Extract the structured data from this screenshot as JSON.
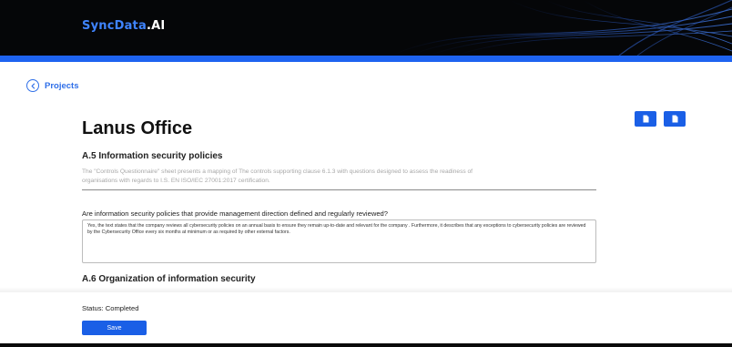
{
  "header": {
    "brand_part1": "SyncData",
    "brand_part2": ".AI",
    "colors": {
      "background": "#050608",
      "brand_blue": "#3f84ff",
      "accent_bar": "#1e63f0"
    }
  },
  "nav": {
    "back_label": "Projects",
    "back_icon": "chevron-left-icon"
  },
  "actions": [
    {
      "icon": "document-icon"
    },
    {
      "icon": "document-icon"
    }
  ],
  "page": {
    "title": "Lanus Office",
    "section_a5": {
      "title": "A.5 Information security policies",
      "description_line1": "The \"Controls Questionnaire\" sheet presents a mapping of The controls supporting clause 6.1.3 with questions designed to assess the readiness of",
      "description_line2": "organisations with regards to I.S. EN ISO/IEC 27001:2017 certification.",
      "question": "Are information security policies that provide management direction defined and regularly reviewed?",
      "answer": "Yes, the text states that the company reviews all cybersecurity policies on an annual basis to ensure they remain up-to-date and relevant for the company . Furthermore, it describes that any exceptions to cybersecurity policies are reviewed by the Cybersecurity Office every six months at minimum or as required by other external factors."
    },
    "section_a6": {
      "title": "A.6 Organization of information security"
    }
  },
  "footer": {
    "status": "Status: Completed",
    "save_label": "Save",
    "primary_color": "#1a5fe6"
  }
}
